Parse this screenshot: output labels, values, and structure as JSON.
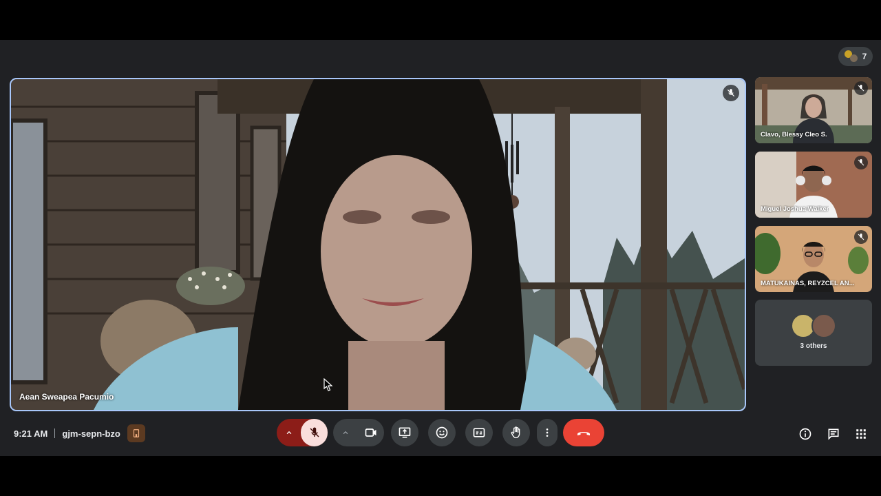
{
  "header": {
    "participant_count": "7"
  },
  "main_video": {
    "speaker_name": "Aean Sweapea Pacumio",
    "muted": true
  },
  "participants": [
    {
      "name": "Clavo, Blessy Cleo S.",
      "muted": true
    },
    {
      "name": "Miguel Joshua Walker",
      "muted": true
    },
    {
      "name": "MATUKAINAS, REYZCEL AN...",
      "muted": true
    }
  ],
  "others": {
    "label": "3 others"
  },
  "meeting": {
    "time": "9:21 AM",
    "code": "gjm-sepn-bzo"
  },
  "controls": {
    "mic": "mic-off",
    "camera": "camera-on",
    "present": "present",
    "reactions": "emoji",
    "captions": "cc",
    "hand": "raise-hand",
    "more": "more-vert",
    "end": "end-call"
  },
  "colors": {
    "background": "#202124",
    "accent_border": "#a8c7fa",
    "end_call": "#ea4335",
    "mic_off_bg": "#f9dedc",
    "mic_off_left": "#8c1d18"
  }
}
